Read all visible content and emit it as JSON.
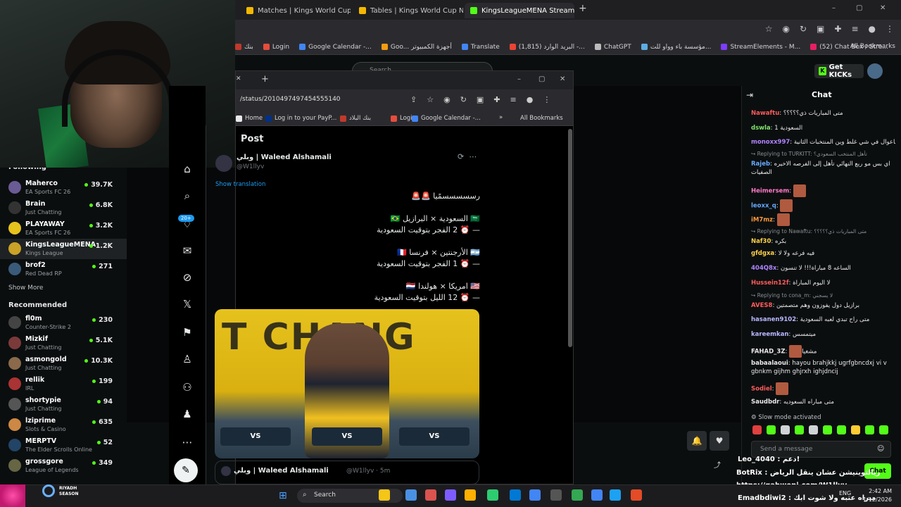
{
  "browser": {
    "tabs": [
      {
        "label": "Matches | Kings World Cup Na",
        "color": "#f5b800"
      },
      {
        "label": "Tables | Kings World Cup Natio",
        "color": "#f5b800"
      },
      {
        "label": "KingsLeagueMENA Stream - W",
        "color": "#53fc18"
      }
    ],
    "new_tab": "+",
    "window_controls": [
      "–",
      "▢",
      "✕"
    ],
    "bookmarks": [
      {
        "label": "بنك",
        "color": "#c0392b"
      },
      {
        "label": "Login",
        "color": "#e74c3c"
      },
      {
        "label": "Google Calendar -...",
        "color": "#4285f4"
      },
      {
        "label": "Goo... أجهزة الكمبيوتر",
        "color": "#f39c12"
      },
      {
        "label": "Translate",
        "color": "#4285f4"
      },
      {
        "label": "البريد الوارد (1,815) -...",
        "color": "#ea4335"
      },
      {
        "label": "ChatGPT",
        "color": "#bbbbbb"
      },
      {
        "label": "مؤسسة باء وواو للت...",
        "color": "#5dade2"
      },
      {
        "label": "StreamElements - M...",
        "color": "#7d3cff"
      },
      {
        "label": "(52) Chat Box / Stre...",
        "color": "#e91e63"
      }
    ],
    "all_bookmarks": "All Bookmarks"
  },
  "kick": {
    "search_placeholder": "Search",
    "get_kicks": "Get KICKs",
    "avatar_label": "بدن",
    "following_heading": "Following",
    "following": [
      {
        "name": "Maherco",
        "category": "EA Sports FC 26",
        "viewers": "39.7K",
        "color": "#6b5b95"
      },
      {
        "name": "Brain",
        "category": "Just Chatting",
        "viewers": "6.8K",
        "color": "#333333"
      },
      {
        "name": "PLAYAWAY",
        "category": "EA Sports FC 26",
        "viewers": "3.2K",
        "color": "#e6c21d"
      },
      {
        "name": "KingsLeagueMENA",
        "category": "Kings League",
        "viewers": "1.2K",
        "color": "#c9a227"
      },
      {
        "name": "brof2",
        "category": "Red Dead RP",
        "viewers": "271",
        "color": "#3a5a7a"
      }
    ],
    "show_more": "Show More",
    "recommended_heading": "Recommended",
    "recommended": [
      {
        "name": "fl0m",
        "category": "Counter-Strike 2",
        "viewers": "230",
        "color": "#444444"
      },
      {
        "name": "Mizkif",
        "category": "Just Chatting",
        "viewers": "5.1K",
        "color": "#7a3a3a"
      },
      {
        "name": "asmongold",
        "category": "Just Chatting",
        "viewers": "10.3K",
        "color": "#8a6a4a"
      },
      {
        "name": "rellik",
        "category": "IRL",
        "viewers": "199",
        "color": "#aa3333"
      },
      {
        "name": "shortypie",
        "category": "Just Chatting",
        "viewers": "94",
        "color": "#555555"
      },
      {
        "name": "lziprime",
        "category": "Slots & Casino",
        "viewers": "635",
        "color": "#cc8844"
      },
      {
        "name": "MERPTV",
        "category": "The Elder Scrolls Online",
        "viewers": "52",
        "color": "#224466"
      },
      {
        "name": "grossgore",
        "category": "League of Legends",
        "viewers": "349",
        "color": "#666644"
      }
    ]
  },
  "xwindow": {
    "url": "/status/2010497497454555140",
    "bookmarks": [
      {
        "label": "Home",
        "color": "#e7e9ea"
      },
      {
        "label": "Log in to your PayP...",
        "color": "#003087"
      },
      {
        "label": "بنك البلاد",
        "color": "#c0392b"
      },
      {
        "label": "Login",
        "color": "#e74c3c"
      },
      {
        "label": "Google Calendar -...",
        "color": "#4285f4"
      }
    ],
    "more": "»",
    "all_bookmarks": "All Bookmarks",
    "nav_badge": "20+",
    "post": {
      "title": "Post",
      "author": "وبلي | Waleed Alshamali",
      "handle": "@W1llyv",
      "show_translation": "Show translation",
      "lines": [
        "رسسسسسمًيا 🚨🚨",
        "🇸🇦 السعودية × البرازيل 🇧🇷",
        "— ⏰ 2 الفجر بتوقيت السعودية",
        "🇦🇷 الأرجنتين × فرنسا 🇫🇷",
        "— ⏰ 1 الفجر بتوقيت السعودية",
        "🇺🇸 امريكا × هولندا 🇳🇱",
        "— ⏰ 12 الليل بتوقيت السعودية"
      ],
      "media_text": "T CHANG",
      "vs_labels": [
        "VS",
        "VS",
        "VS"
      ],
      "reply_author": "وبلي | Waleed Alshamali",
      "reply_handle": "@W1llyv · 5m"
    }
  },
  "chat": {
    "title": "Chat",
    "messages": [
      {
        "user": "Nawaftu",
        "color": "#ff5c5c",
        "text": "متى المباريات ذي؟؟؟؟؟",
        "emote": false
      },
      {
        "user": "dswla",
        "color": "#7ee36b",
        "text": "السعودية 1",
        "emote": false
      },
      {
        "user": "monoxx997",
        "color": "#b084ff",
        "text": "ياعوال في شي غلط وين المنتخبات الثانية",
        "emote": false
      },
      {
        "reply": "Replying to TURKITT: تأهل المنتخب السعودي؟",
        "user": "Rajeb",
        "color": "#66aaff",
        "text": "اي بس مو ربع النهائي تأهل إلى الفرصه الاخيره الصفيات",
        "emote": false
      },
      {
        "user": "Heimersem",
        "color": "#ff7ac8",
        "text": "",
        "emote": true
      },
      {
        "user": "leoxx_q",
        "color": "#66aaff",
        "text": "",
        "emote": true
      },
      {
        "user": "iM7mz",
        "color": "#ff9a3c",
        "text": "",
        "emote": true
      },
      {
        "reply": "Replying to Nawaftu: متى المباريات ذي؟؟؟؟؟",
        "user": "Naf30",
        "color": "#ffd24a",
        "text": "بكره",
        "emote": false
      },
      {
        "user": "gfdgxa",
        "color": "#ffd24a",
        "text": "فيه فرعه ولا لا",
        "emote": false
      },
      {
        "user": "404Q8x",
        "color": "#b084ff",
        "text": "الساعه 8 مباراة!!! لا تنسون",
        "emote": false
      },
      {
        "user": "Hussein12f",
        "color": "#ff5c5c",
        "text": "لا اليوم المباراة",
        "emote": false
      },
      {
        "reply": "Replying to cona_m: لا يسجني",
        "user": "AVES8",
        "color": "#ff5c5c",
        "text": "برازيل دول يفوزون وهم متصمتين",
        "emote": false
      },
      {
        "user": "hasanen9102",
        "color": "#b8b8ff",
        "text": "متى راح تبدي لعبه السعودية",
        "emote": false
      },
      {
        "user": "kareemkan",
        "color": "#b8b8ff",
        "text": "ميتمسس",
        "emote": false
      },
      {
        "user": "FAHAD_3Z",
        "color": "#e8e8ea",
        "text": "مشغيا",
        "emote": true
      },
      {
        "user": "babaalaoui",
        "color": "#e8e8ea",
        "text": "hayou brahjkkj ugrfgbncdxj vi v gbnkm gijhm ghjrxh ighjdncij",
        "emote": false
      },
      {
        "user": "Sodiel",
        "color": "#ff5c5c",
        "text": "",
        "emote": true
      },
      {
        "user": "Saudbdr",
        "color": "#e8e8ea",
        "text": "متى مباراه السعوديه",
        "emote": false
      }
    ],
    "slow_mode": "Slow mode activated",
    "emote_colors": [
      "#e04040",
      "#53fc18",
      "#cfd3d6",
      "#53fc18",
      "#cfd3d6",
      "#53fc18",
      "#53fc18",
      "#ffcc33",
      "#53fc18",
      "#53fc18"
    ],
    "input_placeholder": "Send a message",
    "send_label": "Chat"
  },
  "stream_overlay": {
    "line1": "Leo_4040 : دعم!",
    "line2": "BotRix : ريالتوينيشن عشان ينقل الرياض",
    "line3": "https://gahweni.com/W1llyv",
    "line4": "Emadbdiwi2 : مبراه عتبه ولا شوت ابك"
  },
  "taskbar": {
    "search": "Search",
    "time": "2:42 AM",
    "date": "1/12/2026",
    "riyadh_line1": "RIYADH",
    "riyadh_line2": "SEASON",
    "lang": "ENG",
    "icon_colors": [
      "#f5c518",
      "#4a90e2",
      "#d9534f",
      "#7d5cff",
      "#ffb000",
      "#2ecc71",
      "#0078d4",
      "#4285f4",
      "#555555",
      "#34a853",
      "#4285f4",
      "#1da1f2",
      "#e34c26"
    ]
  }
}
